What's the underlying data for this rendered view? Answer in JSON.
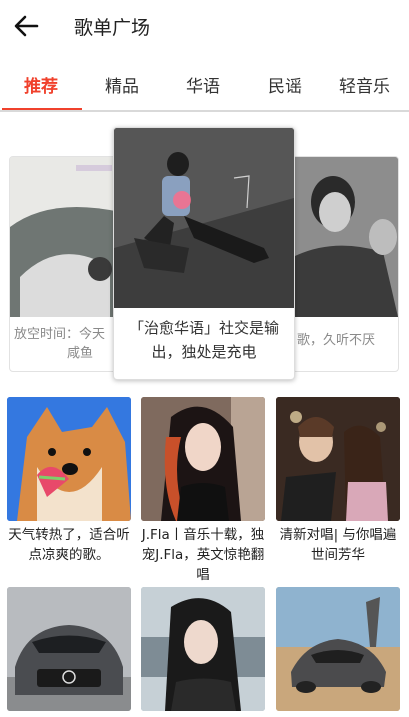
{
  "header": {
    "title": "歌单广场",
    "back_icon": "back-arrow-icon"
  },
  "tabs": [
    {
      "label": "推荐",
      "active": true
    },
    {
      "label": "精品",
      "active": false
    },
    {
      "label": "华语",
      "active": false
    },
    {
      "label": "民谣",
      "active": false
    },
    {
      "label": "轻音乐",
      "active": false
    }
  ],
  "colors": {
    "accent": "#f0412c"
  },
  "banner": {
    "left": {
      "caption_line1": "放空时间：今天",
      "caption_line2": "咸鱼"
    },
    "center": {
      "caption": "「治愈华语」社交是输出，独处是充电"
    },
    "right": {
      "caption": "歌，久听不厌"
    }
  },
  "playlists": [
    {
      "title": "天气转热了，适合听点凉爽的歌。"
    },
    {
      "title": "J.Fla丨音乐十载，独宠J.Fla，英文惊艳翻唱"
    },
    {
      "title": "清新对唱| 与你唱遍世间芳华"
    },
    {
      "title": ""
    },
    {
      "title": ""
    },
    {
      "title": ""
    }
  ]
}
